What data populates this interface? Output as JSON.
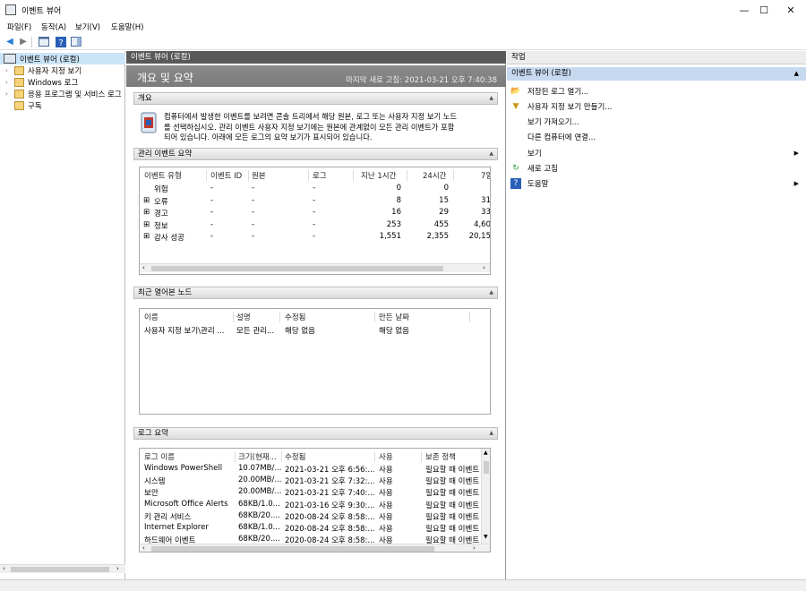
{
  "window": {
    "title": "이벤트 뷰어",
    "minimize": "—",
    "maximize": "☐",
    "close": "✕"
  },
  "menu": [
    "파일(F)",
    "동작(A)",
    "보기(V)",
    "도움말(H)"
  ],
  "tree": {
    "root": "이벤트 뷰어 (로컬)",
    "items": [
      "사용자 지정 보기",
      "Windows 로그",
      "응용 프로그램 및 서비스 로그",
      "구독"
    ]
  },
  "center": {
    "header": "이벤트 뷰어 (로컬)",
    "title": "개요 및 요약",
    "last_refresh": "마지막 새로 고침: 2021-03-21 오후 7:40:38",
    "overview": {
      "label": "개요",
      "text_line1": "컴퓨터에서 발생한 이벤트를 보려면 콘솔 트리에서 해당 원본, 로그 또는 사용자 지정 보기 노드",
      "text_line2": "를 선택하십시오. 관리 이벤트 사용자 지정 보기에는 원본에 관계없이 모든 관리 이벤트가 포함",
      "text_line3": "되어 있습니다. 아래에 모든 로그의 요약 보기가 표시되어 있습니다."
    },
    "admin_summary": {
      "label": "관리 이벤트 요약",
      "columns": [
        "이벤트 유형",
        "이벤트 ID",
        "원본",
        "로그",
        "지난 1시간",
        "24시간",
        "7일"
      ],
      "rows": [
        {
          "type": "위험",
          "id": "-",
          "source": "-",
          "log": "-",
          "h1": "0",
          "h24": "0",
          "d7": "",
          "expand": ""
        },
        {
          "type": "오류",
          "id": "-",
          "source": "-",
          "log": "-",
          "h1": "8",
          "h24": "15",
          "d7": "31",
          "expand": "⊞"
        },
        {
          "type": "경고",
          "id": "-",
          "source": "-",
          "log": "-",
          "h1": "16",
          "h24": "29",
          "d7": "33",
          "expand": "⊞"
        },
        {
          "type": "정보",
          "id": "-",
          "source": "-",
          "log": "-",
          "h1": "253",
          "h24": "455",
          "d7": "4,60",
          "expand": "⊞"
        },
        {
          "type": "감사 성공",
          "id": "-",
          "source": "-",
          "log": "-",
          "h1": "1,551",
          "h24": "2,355",
          "d7": "20,15",
          "expand": "⊞"
        }
      ]
    },
    "recent_nodes": {
      "label": "최근 열어본 노드",
      "columns": [
        "이름",
        "설명",
        "수정됨",
        "만든 날짜"
      ],
      "rows": [
        {
          "name": "사용자 지정 보기\\관리 ...",
          "desc": "모든 관리...",
          "modified": "해당 없음",
          "created": "해당 없음"
        }
      ]
    },
    "log_summary": {
      "label": "로그 요약",
      "columns": [
        "로그 이름",
        "크기(현재...",
        "수정됨",
        "사용",
        "보존 정책"
      ],
      "rows": [
        {
          "name": "Windows PowerShell",
          "size": "10.07MB/...",
          "modified": "2021-03-21 오후 6:56:...",
          "enabled": "사용",
          "policy": "필요할 때 이벤트"
        },
        {
          "name": "시스템",
          "size": "20.00MB/...",
          "modified": "2021-03-21 오후 7:32:...",
          "enabled": "사용",
          "policy": "필요할 때 이벤트"
        },
        {
          "name": "보안",
          "size": "20.00MB/...",
          "modified": "2021-03-21 오후 7:40:...",
          "enabled": "사용",
          "policy": "필요할 때 이벤트"
        },
        {
          "name": "Microsoft Office Alerts",
          "size": "68KB/1.0...",
          "modified": "2021-03-16 오후 9:30:...",
          "enabled": "사용",
          "policy": "필요할 때 이벤트"
        },
        {
          "name": "키 관리 서비스",
          "size": "68KB/20....",
          "modified": "2020-08-24 오후 8:58:...",
          "enabled": "사용",
          "policy": "필요할 때 이벤트"
        },
        {
          "name": "Internet Explorer",
          "size": "68KB/1.0...",
          "modified": "2020-08-24 오후 8:58:...",
          "enabled": "사용",
          "policy": "필요할 때 이벤트"
        },
        {
          "name": "하드웨어 이벤트",
          "size": "68KB/20....",
          "modified": "2020-08-24 오후 8:58:...",
          "enabled": "사용",
          "policy": "필요할 때 이벤트"
        }
      ]
    }
  },
  "actions": {
    "header": "작업",
    "section": "이벤트 뷰어 (로컬)",
    "items": [
      {
        "label": "저장된 로그 열기...",
        "icon": "folder-icon",
        "glyph": "📂",
        "submenu": ""
      },
      {
        "label": "사용자 지정 보기 만들기...",
        "icon": "filter-icon",
        "glyph": "▼",
        "submenu": ""
      },
      {
        "label": "보기 가져오기...",
        "icon": "",
        "glyph": "",
        "submenu": ""
      },
      {
        "label": "다른 컴퓨터에 연결...",
        "icon": "",
        "glyph": "",
        "submenu": ""
      },
      {
        "label": "보기",
        "icon": "",
        "glyph": "",
        "submenu": "▶"
      },
      {
        "label": "새로 고침",
        "icon": "refresh-icon",
        "glyph": "↻",
        "submenu": ""
      },
      {
        "label": "도움말",
        "icon": "help-icon",
        "glyph": "?",
        "submenu": "▶"
      }
    ]
  }
}
